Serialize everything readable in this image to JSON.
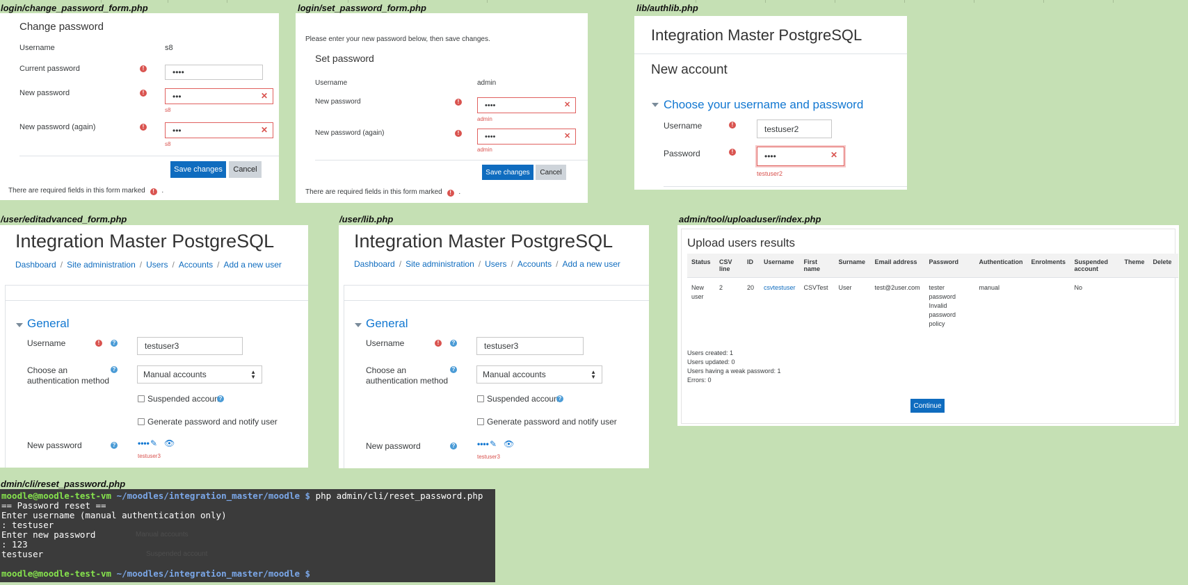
{
  "captions": {
    "change_pw": "login/change_password_form.php",
    "set_pw": "login/set_password_form.php",
    "authlib": "lib/authlib.php",
    "editadvanced": "/user/editadvanced_form.php",
    "userlib": "/user/lib.php",
    "userupload": "admin/tool/uploaduser/index.php",
    "cli": "dmin/cli/reset_password.php"
  },
  "change_pw": {
    "title": "Change password",
    "username_label": "Username",
    "username_value": "s8",
    "current_label": "Current password",
    "current_value": "••••",
    "new_label": "New password",
    "new_value": "•••",
    "new_error": "s8",
    "again_label": "New password (again)",
    "again_value": "•••",
    "again_error": "s8",
    "save": "Save changes",
    "cancel": "Cancel",
    "required_note": "There are required fields in this form marked",
    "required_tail": "."
  },
  "set_pw": {
    "intro": "Please enter your new password below, then save changes.",
    "title": "Set password",
    "username_label": "Username",
    "username_value": "admin",
    "new_label": "New password",
    "new_value": "••••",
    "new_error": "admin",
    "again_label": "New password (again)",
    "again_value": "••••",
    "again_error": "admin",
    "save": "Save changes",
    "cancel": "Cancel",
    "required_note": "There are required fields in this form marked",
    "required_tail": "."
  },
  "authlib": {
    "site": "Integration Master PostgreSQL",
    "heading": "New account",
    "section": "Choose your username and password",
    "username_label": "Username",
    "username_value": "testuser2",
    "password_label": "Password",
    "password_value": "••••",
    "password_error": "testuser2"
  },
  "editadvanced": {
    "site": "Integration Master PostgreSQL",
    "breadcrumb": [
      "Dashboard",
      "Site administration",
      "Users",
      "Accounts",
      "Add a new user"
    ],
    "section": "General",
    "username_label": "Username",
    "username_value": "testuser3",
    "auth_label_1": "Choose an",
    "auth_label_2": "authentication method",
    "auth_value": "Manual accounts",
    "suspended": "Suspended account",
    "generate": "Generate password and notify user",
    "newpw_label": "New password",
    "newpw_value": "••••",
    "newpw_error": "testuser3"
  },
  "userlib": {
    "site": "Integration Master PostgreSQL",
    "breadcrumb": [
      "Dashboard",
      "Site administration",
      "Users",
      "Accounts",
      "Add a new user"
    ],
    "section": "General",
    "username_label": "Username",
    "username_value": "testuser3",
    "auth_label_1": "Choose an",
    "auth_label_2": "authentication method",
    "auth_value": "Manual accounts",
    "suspended": "Suspended account",
    "generate": "Generate password and notify user",
    "newpw_label": "New password",
    "newpw_value": "••••",
    "newpw_error": "testuser3"
  },
  "userupload": {
    "title": "Upload users results",
    "headers": [
      "Status",
      "CSV line",
      "ID",
      "Username",
      "First name",
      "Surname",
      "Email address",
      "Password",
      "Authentication",
      "Enrolments",
      "Suspended account",
      "Theme",
      "Delete"
    ],
    "row": [
      "New user",
      "2",
      "20",
      "csvtestuser",
      "CSVTest",
      "User",
      "test@2user.com",
      "tester password Invalid password policy",
      "manual",
      "",
      "No",
      "",
      ""
    ],
    "summary": [
      "Users created: 1",
      "Users updated: 0",
      "Users having a weak password: 1",
      "Errors: 0"
    ],
    "continue": "Continue"
  },
  "cli": {
    "prompt_user": "moodle@moodle-test-vm",
    "prompt_path": "~/moodles/integration_master/moodle $",
    "command": "php admin/cli/reset_password.php",
    "lines": [
      "== Password reset ==",
      "Enter username (manual authentication only)",
      ": testuser",
      "Enter new password",
      ": 123",
      "testuser"
    ],
    "ghost_select": "Manual accounts",
    "ghost_check": "Suspended account"
  }
}
